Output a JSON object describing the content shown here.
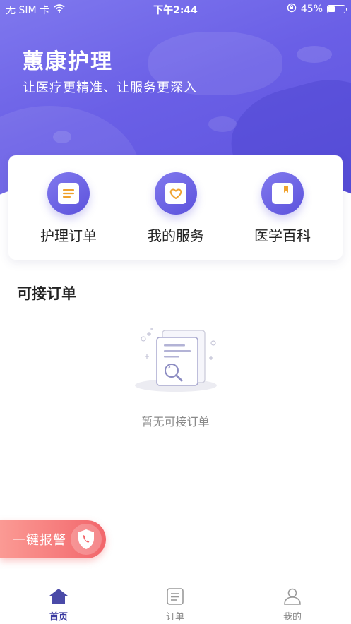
{
  "status_bar": {
    "carrier": "无 SIM 卡",
    "time": "下午2:44",
    "battery": "45%",
    "battery_level": 0.45
  },
  "header": {
    "title": "蕙康护理",
    "subtitle": "让医疗更精准、让服务更深入"
  },
  "quick_actions": [
    {
      "label": "护理订单",
      "icon": "document-list-icon"
    },
    {
      "label": "我的服务",
      "icon": "heart-card-icon"
    },
    {
      "label": "医学百科",
      "icon": "bookmark-book-icon"
    }
  ],
  "orders_section": {
    "title": "可接订单",
    "empty_text": "暂无可接订单"
  },
  "alarm_button": {
    "label": "一键报警",
    "icon": "shield-phone-icon"
  },
  "tab_bar": {
    "tabs": [
      {
        "label": "首页",
        "icon": "home-icon",
        "active": true
      },
      {
        "label": "订单",
        "icon": "order-list-icon",
        "active": false
      },
      {
        "label": "我的",
        "icon": "user-icon",
        "active": false
      }
    ]
  },
  "colors": {
    "primary": "#6a5fe6",
    "accent_orange": "#f0a22e",
    "alarm": "#f2666b",
    "tab_active": "#3a3aa0"
  }
}
